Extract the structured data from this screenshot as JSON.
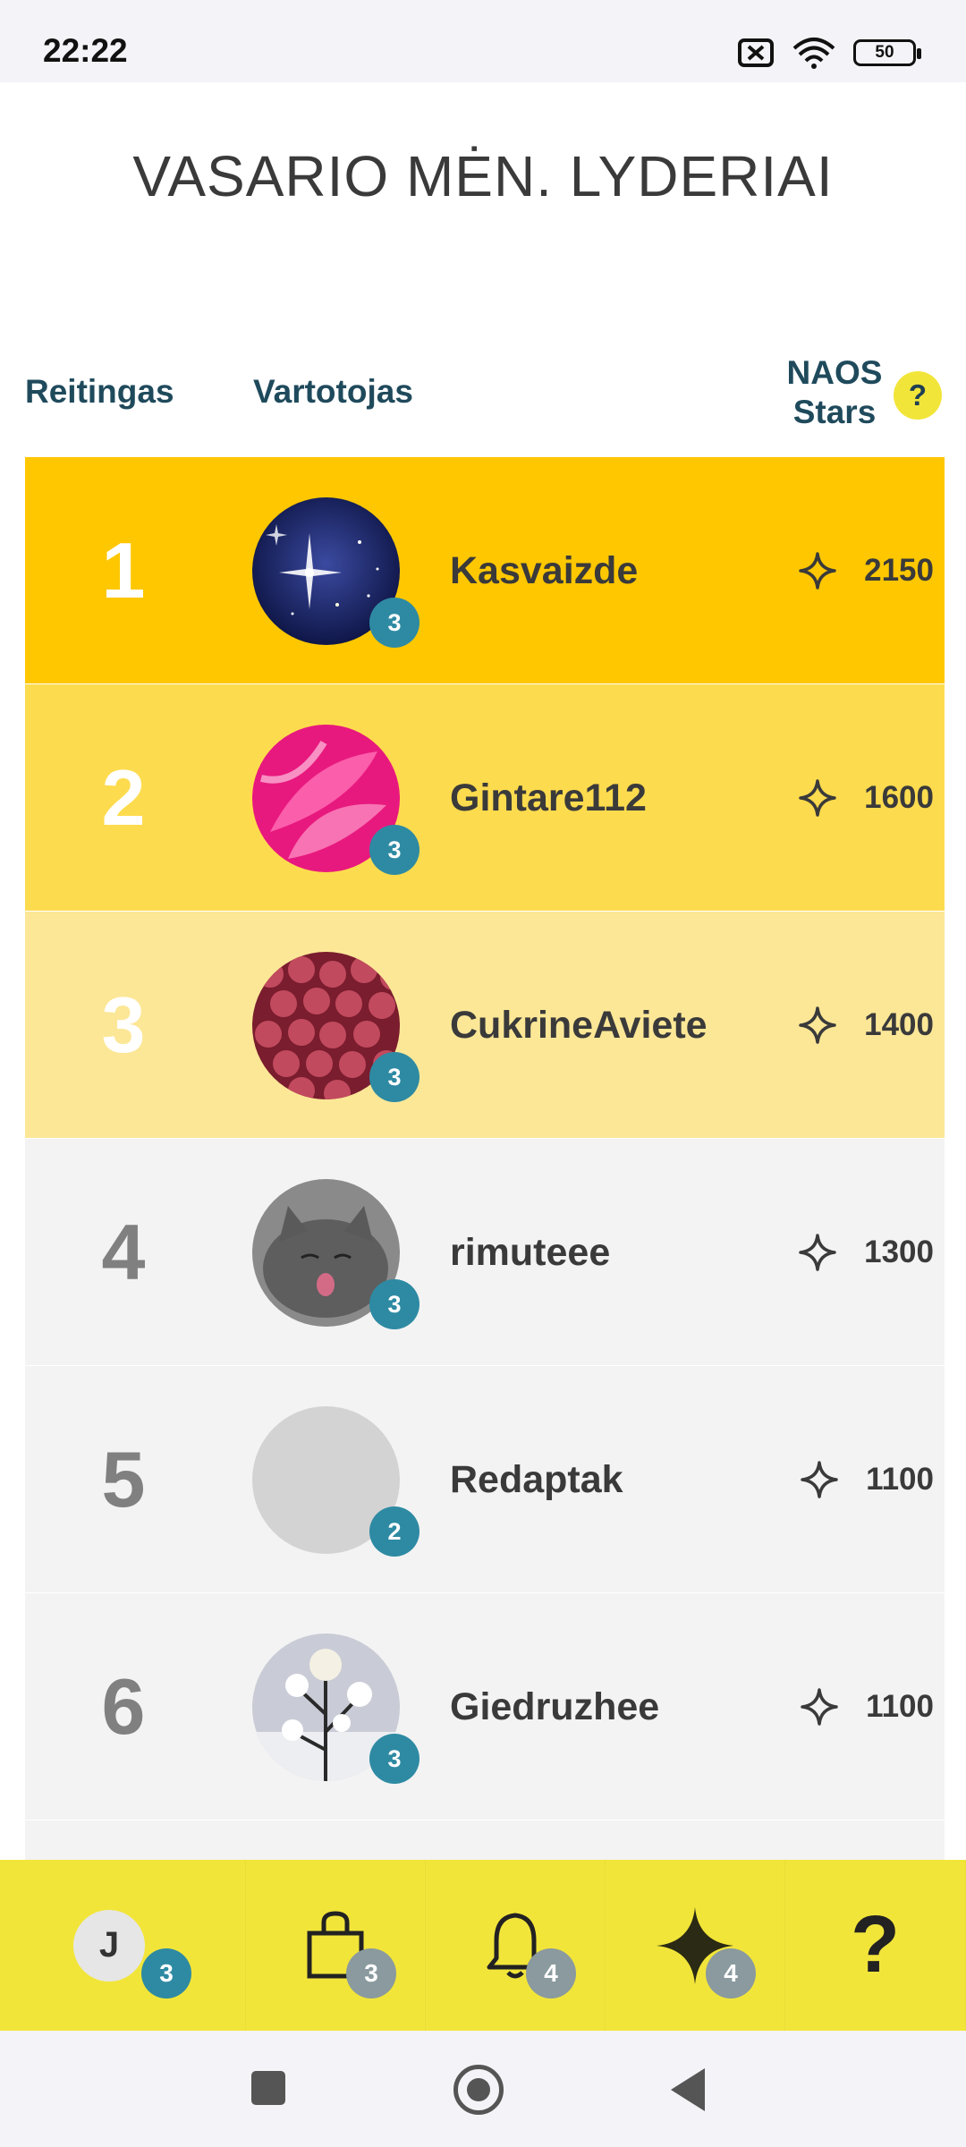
{
  "status_bar": {
    "time": "22:22",
    "battery": "50"
  },
  "page": {
    "title": "VASARIO MĖN. LYDERIAI"
  },
  "table_header": {
    "rank_label": "Reitingas",
    "user_label": "Vartotojas",
    "stars_label": "NAOS Stars",
    "help_label": "?"
  },
  "colors": {
    "rank1_bg": "#fec700",
    "rank2_bg": "#fddb4e",
    "rank3_bg": "#fce797",
    "other_bg": "#f3f3f3",
    "level_badge": "#2e8aa3",
    "nav_bg": "#f2e53a"
  },
  "leaders": [
    {
      "rank": "1",
      "username": "Kasvaizde",
      "level": "3",
      "stars": "2150",
      "avatar": "starfield-avatar"
    },
    {
      "rank": "2",
      "username": "Gintare112",
      "level": "3",
      "stars": "1600",
      "avatar": "pink-flower-avatar"
    },
    {
      "rank": "3",
      "username": "CukrineAviete",
      "level": "3",
      "stars": "1400",
      "avatar": "raspberries-avatar"
    },
    {
      "rank": "4",
      "username": "rimuteee",
      "level": "3",
      "stars": "1300",
      "avatar": "grey-cat-avatar"
    },
    {
      "rank": "5",
      "username": "Redaptak",
      "level": "2",
      "stars": "1100",
      "avatar": "empty-avatar"
    },
    {
      "rank": "6",
      "username": "Giedruzhee",
      "level": "3",
      "stars": "1100",
      "avatar": "snowy-plant-avatar"
    }
  ],
  "bottom_nav": {
    "profile_initial": "J",
    "profile_badge": "3",
    "shop_badge": "3",
    "notifications_badge": "4",
    "stars_badge": "4",
    "help_label": "?"
  }
}
